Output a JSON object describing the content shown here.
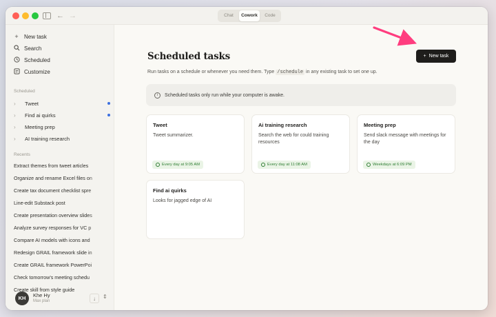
{
  "titlebar": {
    "modes": [
      "Chat",
      "Cowork",
      "Code"
    ],
    "active_mode": "Cowork"
  },
  "sidebar": {
    "nav": [
      {
        "label": "New task",
        "icon": "plus-icon"
      },
      {
        "label": "Search",
        "icon": "search-icon"
      },
      {
        "label": "Scheduled",
        "icon": "clock-icon"
      },
      {
        "label": "Customize",
        "icon": "customize-icon"
      }
    ],
    "scheduled_label": "Scheduled",
    "scheduled": [
      {
        "label": "Tweet",
        "unread": true
      },
      {
        "label": "Find ai quirks",
        "unread": true
      },
      {
        "label": "Meeting prep",
        "unread": false
      },
      {
        "label": "AI training research",
        "unread": false
      }
    ],
    "recents_label": "Recents",
    "recents": [
      "Extract themes from tweet articles",
      "Organize and rename Excel files on",
      "Create tax document checklist spre",
      "Line-edit Substack post",
      "Create presentation overview slides",
      "Analyze survey responses for VC p",
      "Compare AI models with icons and",
      "Redesign GRAIL framework slide in",
      "Create GRAIL framework PowerPoi",
      "Check tomorrow's meeting schedu",
      "Create skill from style guide"
    ],
    "user": {
      "initials": "KH",
      "name": "Khe Hy",
      "sub": "Max plan"
    }
  },
  "main": {
    "title": "Scheduled tasks",
    "new_task_label": "New task",
    "subtitle_before": "Run tasks on a schedule or whenever you need them. Type",
    "subtitle_code": "/schedule",
    "subtitle_after": "in any existing task to set one up.",
    "notice": "Scheduled tasks only run while your computer is awake.",
    "cards": [
      {
        "title": "Tweet",
        "desc": "Tweet summarizer.",
        "schedule": "Every day at 9:05 AM"
      },
      {
        "title": "Ai training research",
        "desc": "Search the web for could training resources",
        "schedule": "Every day at 11:08 AM"
      },
      {
        "title": "Meeting prep",
        "desc": "Send slack message with meetings for the day",
        "schedule": "Weekdays at 6:09 PM"
      },
      {
        "title": "Find ai quirks",
        "desc": "Looks for jagged edge of AI",
        "schedule": ""
      }
    ]
  },
  "colors": {
    "accent_dark": "#1e1d1b",
    "badge_green": "#2e7d32",
    "unread_dot": "#3b6fe0",
    "annotation_arrow": "#ff3d7f"
  }
}
